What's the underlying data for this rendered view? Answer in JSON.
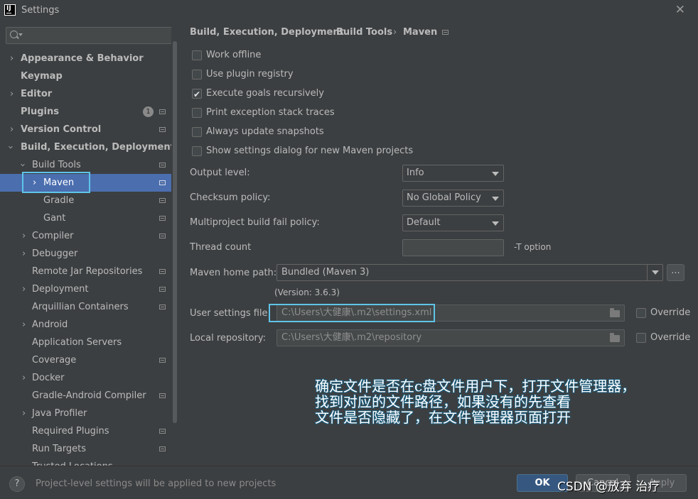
{
  "window": {
    "title": "Settings",
    "logo_text": "IJ"
  },
  "search": {
    "placeholder": ""
  },
  "sidebar": {
    "items": [
      {
        "label": "Appearance & Behavior"
      },
      {
        "label": "Keymap"
      },
      {
        "label": "Editor"
      },
      {
        "label": "Plugins",
        "badge": "1"
      },
      {
        "label": "Version Control"
      },
      {
        "label": "Build, Execution, Deployment"
      },
      {
        "label": "Build Tools"
      },
      {
        "label": "Maven"
      },
      {
        "label": "Gradle"
      },
      {
        "label": "Gant"
      },
      {
        "label": "Compiler"
      },
      {
        "label": "Debugger"
      },
      {
        "label": "Remote Jar Repositories"
      },
      {
        "label": "Deployment"
      },
      {
        "label": "Arquillian Containers"
      },
      {
        "label": "Android"
      },
      {
        "label": "Application Servers"
      },
      {
        "label": "Coverage"
      },
      {
        "label": "Docker"
      },
      {
        "label": "Gradle-Android Compiler"
      },
      {
        "label": "Java Profiler"
      },
      {
        "label": "Required Plugins"
      },
      {
        "label": "Run Targets"
      },
      {
        "label": "Trusted Locations"
      }
    ]
  },
  "breadcrumb": {
    "items": [
      "Build, Execution, Deployment",
      "Build Tools",
      "Maven"
    ],
    "separator": "›"
  },
  "options": [
    {
      "label": "Work offline",
      "checked": false
    },
    {
      "label": "Use plugin registry",
      "checked": false
    },
    {
      "label": "Execute goals recursively",
      "checked": true
    },
    {
      "label": "Print exception stack traces",
      "checked": false
    },
    {
      "label": "Always update snapshots",
      "checked": false
    },
    {
      "label": "Show settings dialog for new Maven projects",
      "checked": false
    }
  ],
  "fields": {
    "output_level": {
      "label": "Output level:",
      "value": "Info"
    },
    "checksum_policy": {
      "label": "Checksum policy:",
      "value": "No Global Policy"
    },
    "multiproject_policy": {
      "label": "Multiproject build fail policy:",
      "value": "Default"
    },
    "thread_count": {
      "label": "Thread count",
      "value": "",
      "suffix": "-T option"
    },
    "maven_home": {
      "label": "Maven home path:",
      "value": "Bundled (Maven 3)",
      "browse": "...",
      "version": "(Version: 3.6.3)"
    },
    "user_settings": {
      "label": "User settings file:",
      "value": "C:\\Users\\大健康\\.m2\\settings.xml",
      "override_label": "Override",
      "override_checked": false
    },
    "local_repo": {
      "label": "Local repository:",
      "value": "C:\\Users\\大健康\\.m2\\repository",
      "override_label": "Override",
      "override_checked": false
    }
  },
  "annotation": {
    "lines": [
      "确定文件是否在c盘文件用户下，打开文件管理器，",
      "找到对应的文件路径，如果没有的先查看",
      "文件是否隐藏了，在文件管理器页面打开"
    ]
  },
  "footer": {
    "help": "?",
    "note": "Project-level settings will be applied to new projects",
    "ok": "OK",
    "cancel": "Cancel",
    "apply": "Apply",
    "watermark": "CSDN @放弃    治疗"
  },
  "colors": {
    "background": "#3c3f41",
    "selection": "#4b6eaf",
    "highlight_box": "#5fc4e8",
    "ok_button": "#365880"
  }
}
